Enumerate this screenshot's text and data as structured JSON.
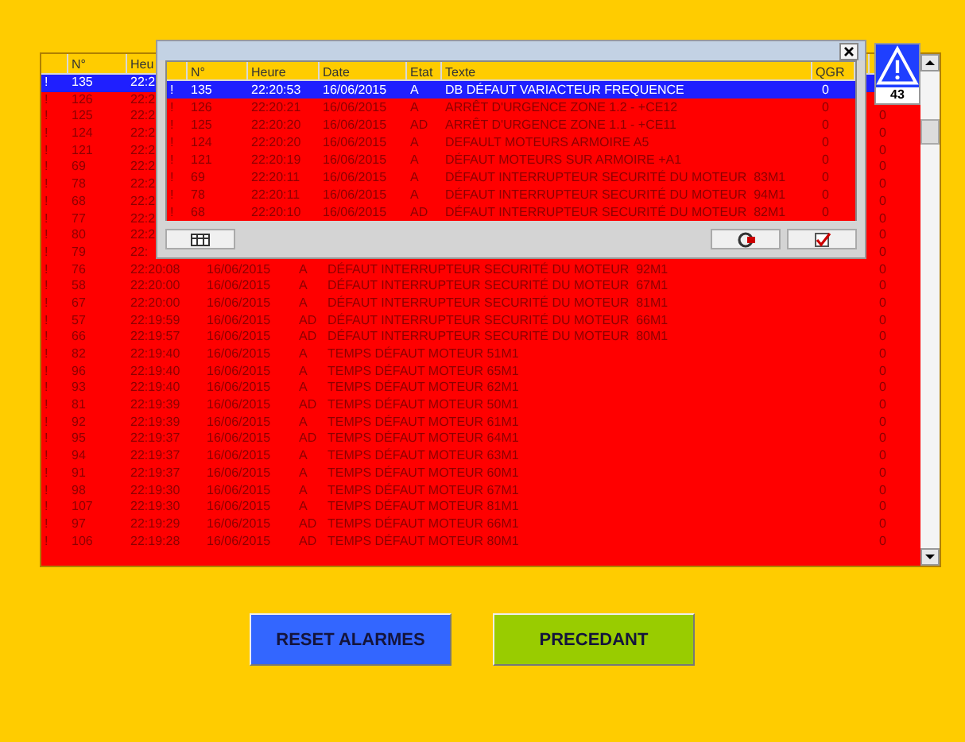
{
  "alarm_list": {
    "columns": [
      {},
      {
        "label": "N°"
      },
      {
        "label": "Heu"
      }
    ],
    "rows": [
      {
        "marker": "!",
        "number": "135",
        "time": "22:2",
        "selected": true
      },
      {
        "marker": "!",
        "number": "126",
        "time": "22:2",
        "selected": false
      },
      {
        "marker": "!",
        "number": "125",
        "time": "22:2",
        "qgr": "0",
        "selected": false
      },
      {
        "marker": "!",
        "number": "124",
        "time": "22:2",
        "qgr": "0",
        "selected": false
      },
      {
        "marker": "!",
        "number": "121",
        "time": "22:2",
        "qgr": "0",
        "selected": false
      },
      {
        "marker": "!",
        "number": "69",
        "time": "22:2",
        "qgr": "0",
        "selected": false
      },
      {
        "marker": "!",
        "number": "78",
        "time": "22:2",
        "qgr": "0",
        "selected": false
      },
      {
        "marker": "!",
        "number": "68",
        "time": "22:2",
        "qgr": "0",
        "selected": false
      },
      {
        "marker": "!",
        "number": "77",
        "time": "22:2",
        "qgr": "0",
        "selected": false
      },
      {
        "marker": "!",
        "number": "80",
        "time": "22:2",
        "qgr": "0",
        "selected": false
      },
      {
        "marker": "!",
        "number": "79",
        "time": "22:",
        "qgr": "0",
        "selected": false
      },
      {
        "marker": "!",
        "number": "76",
        "time": "22:20:08",
        "date": "16/06/2015",
        "state": "A",
        "text": "DÉFAUT INTERRUPTEUR SECURITÉ DU MOTEUR  92M1",
        "qgr": "0",
        "selected": false
      },
      {
        "marker": "!",
        "number": "58",
        "time": "22:20:00",
        "date": "16/06/2015",
        "state": "A",
        "text": "DÉFAUT INTERRUPTEUR SECURITÉ DU MOTEUR  67M1",
        "qgr": "0",
        "selected": false
      },
      {
        "marker": "!",
        "number": "67",
        "time": "22:20:00",
        "date": "16/06/2015",
        "state": "A",
        "text": "DÉFAUT INTERRUPTEUR SECURITÉ DU MOTEUR  81M1",
        "qgr": "0",
        "selected": false
      },
      {
        "marker": "!",
        "number": "57",
        "time": "22:19:59",
        "date": "16/06/2015",
        "state": "AD",
        "text": "DÉFAUT INTERRUPTEUR SECURITÉ DU MOTEUR  66M1",
        "qgr": "0",
        "selected": false
      },
      {
        "marker": "!",
        "number": "66",
        "time": "22:19:57",
        "date": "16/06/2015",
        "state": "AD",
        "text": "DÉFAUT INTERRUPTEUR SECURITÉ DU MOTEUR  80M1",
        "qgr": "0",
        "selected": false
      },
      {
        "marker": "!",
        "number": "82",
        "time": "22:19:40",
        "date": "16/06/2015",
        "state": "A",
        "text": "TEMPS DÉFAUT MOTEUR 51M1",
        "qgr": "0",
        "selected": false
      },
      {
        "marker": "!",
        "number": "96",
        "time": "22:19:40",
        "date": "16/06/2015",
        "state": "A",
        "text": "TEMPS DÉFAUT MOTEUR 65M1",
        "qgr": "0",
        "selected": false
      },
      {
        "marker": "!",
        "number": "93",
        "time": "22:19:40",
        "date": "16/06/2015",
        "state": "A",
        "text": "TEMPS DÉFAUT MOTEUR 62M1",
        "qgr": "0",
        "selected": false
      },
      {
        "marker": "!",
        "number": "81",
        "time": "22:19:39",
        "date": "16/06/2015",
        "state": "AD",
        "text": "TEMPS DÉFAUT MOTEUR 50M1",
        "qgr": "0",
        "selected": false
      },
      {
        "marker": "!",
        "number": "92",
        "time": "22:19:39",
        "date": "16/06/2015",
        "state": "A",
        "text": "TEMPS DÉFAUT MOTEUR 61M1",
        "qgr": "0",
        "selected": false
      },
      {
        "marker": "!",
        "number": "95",
        "time": "22:19:37",
        "date": "16/06/2015",
        "state": "AD",
        "text": "TEMPS DÉFAUT MOTEUR 64M1",
        "qgr": "0",
        "selected": false
      },
      {
        "marker": "!",
        "number": "94",
        "time": "22:19:37",
        "date": "16/06/2015",
        "state": "A",
        "text": "TEMPS DÉFAUT MOTEUR 63M1",
        "qgr": "0",
        "selected": false
      },
      {
        "marker": "!",
        "number": "91",
        "time": "22:19:37",
        "date": "16/06/2015",
        "state": "A",
        "text": "TEMPS DÉFAUT MOTEUR 60M1",
        "qgr": "0",
        "selected": false
      },
      {
        "marker": "!",
        "number": "98",
        "time": "22:19:30",
        "date": "16/06/2015",
        "state": "A",
        "text": "TEMPS DÉFAUT MOTEUR 67M1",
        "qgr": "0",
        "selected": false
      },
      {
        "marker": "!",
        "number": "107",
        "time": "22:19:30",
        "date": "16/06/2015",
        "state": "A",
        "text": "TEMPS DÉFAUT MOTEUR 81M1",
        "qgr": "0",
        "selected": false
      },
      {
        "marker": "!",
        "number": "97",
        "time": "22:19:29",
        "date": "16/06/2015",
        "state": "AD",
        "text": "TEMPS DÉFAUT MOTEUR 66M1",
        "qgr": "0",
        "selected": false
      },
      {
        "marker": "!",
        "number": "106",
        "time": "22:19:28",
        "date": "16/06/2015",
        "state": "AD",
        "text": "TEMPS DÉFAUT MOTEUR 80M1",
        "qgr": "0",
        "selected": false
      }
    ]
  },
  "popup": {
    "columns": [
      {},
      {
        "label": "N°"
      },
      {
        "label": "Heure"
      },
      {
        "label": "Date"
      },
      {
        "label": "Etat"
      },
      {
        "label": "Texte"
      },
      {
        "label": "QGR"
      }
    ],
    "rows": [
      {
        "marker": "!",
        "number": "135",
        "time": "22:20:53",
        "date": "16/06/2015",
        "state": "A",
        "text": "DB DÉFAUT VARIACTEUR FREQUENCE",
        "qgr": "0",
        "selected": true
      },
      {
        "marker": "!",
        "number": "126",
        "time": "22:20:21",
        "date": "16/06/2015",
        "state": "A",
        "text": "ARRÊT D'URGENCE ZONE 1.2 - +CE12",
        "qgr": "0",
        "selected": false
      },
      {
        "marker": "!",
        "number": "125",
        "time": "22:20:20",
        "date": "16/06/2015",
        "state": "AD",
        "text": "ARRÊT D'URGENCE ZONE 1.1 - +CE11",
        "qgr": "0",
        "selected": false
      },
      {
        "marker": "!",
        "number": "124",
        "time": "22:20:20",
        "date": "16/06/2015",
        "state": "A",
        "text": "DEFAULT MOTEURS ARMOIRE A5",
        "qgr": "0",
        "selected": false
      },
      {
        "marker": "!",
        "number": "121",
        "time": "22:20:19",
        "date": "16/06/2015",
        "state": "A",
        "text": "DÉFAUT MOTEURS SUR ARMOIRE +A1",
        "qgr": "0",
        "selected": false
      },
      {
        "marker": "!",
        "number": "69",
        "time": "22:20:11",
        "date": "16/06/2015",
        "state": "A",
        "text": "DÉFAUT INTERRUPTEUR SECURITÉ DU MOTEUR  83M1",
        "qgr": "0",
        "selected": false
      },
      {
        "marker": "!",
        "number": "78",
        "time": "22:20:11",
        "date": "16/06/2015",
        "state": "A",
        "text": "DÉFAUT INTERRUPTEUR SECURITÉ DU MOTEUR  94M1",
        "qgr": "0",
        "selected": false
      },
      {
        "marker": "!",
        "number": "68",
        "time": "22:20:10",
        "date": "16/06/2015",
        "state": "AD",
        "text": "DÉFAUT INTERRUPTEUR SECURITÉ DU MOTEUR  82M1",
        "qgr": "0",
        "selected": false
      }
    ]
  },
  "alarm_badge": {
    "count": "43"
  },
  "buttons": [
    {
      "label": "RESET ALARMES",
      "kind": "reset"
    },
    {
      "label": "PRECEDANT",
      "kind": "back"
    }
  ]
}
